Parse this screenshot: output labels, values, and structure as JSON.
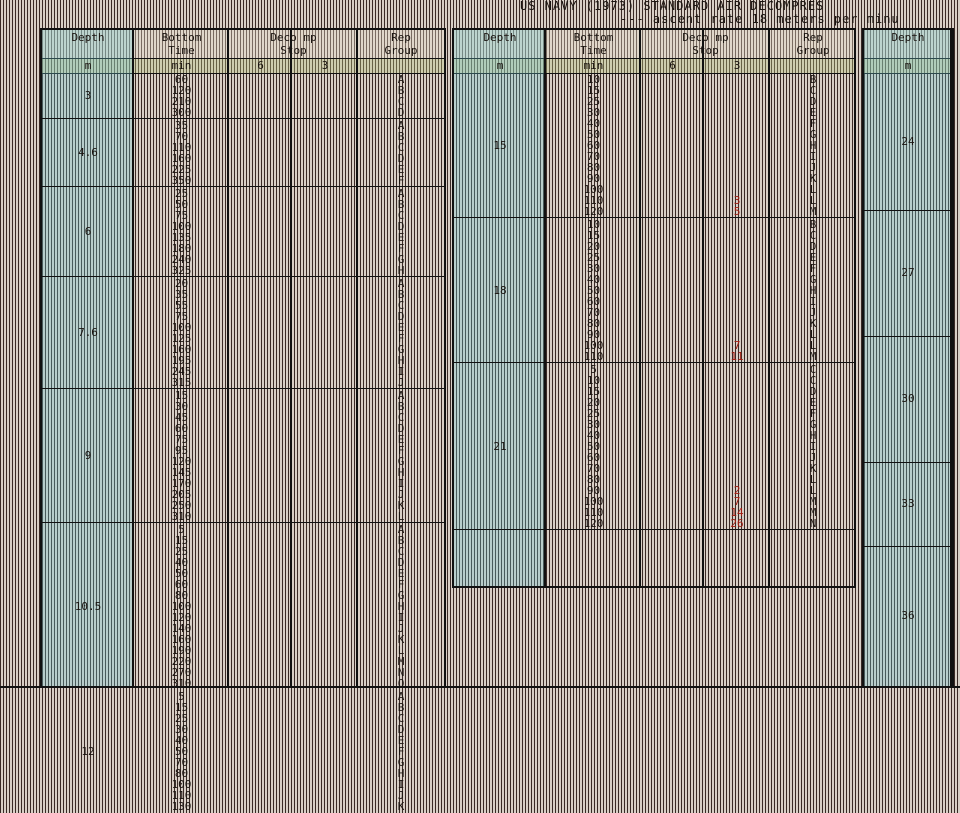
{
  "title": "US  NAVY (1973) STANDARD AIR DECOMPRES",
  "subtitle": "--- ascent rate 18 meters per minu",
  "headers": {
    "depth": "Depth",
    "bottom_time_1": "Bottom",
    "bottom_time_2": "Time",
    "deco_1": "Deco mp",
    "deco_2": "Stop",
    "rep_1": "Rep",
    "rep_2": "Group"
  },
  "units": {
    "depth": "m",
    "time": "min",
    "stop6": "6",
    "stop3": "3"
  },
  "panel1": [
    {
      "depth": "3",
      "rows": [
        [
          "60",
          "",
          "",
          "A"
        ],
        [
          "120",
          "",
          "",
          "B"
        ],
        [
          "210",
          "",
          "",
          "C"
        ],
        [
          "300",
          "",
          "",
          "D"
        ]
      ]
    },
    {
      "depth": "4.6",
      "rows": [
        [
          "35",
          "",
          "",
          "A"
        ],
        [
          "70",
          "",
          "",
          "B"
        ],
        [
          "110",
          "",
          "",
          "C"
        ],
        [
          "160",
          "",
          "",
          "D"
        ],
        [
          "225",
          "",
          "",
          "E"
        ],
        [
          "350",
          "",
          "",
          "F"
        ]
      ]
    },
    {
      "depth": "6",
      "rows": [
        [
          "25",
          "",
          "",
          "A"
        ],
        [
          "50",
          "",
          "",
          "B"
        ],
        [
          "75",
          "",
          "",
          "C"
        ],
        [
          "100",
          "",
          "",
          "D"
        ],
        [
          "135",
          "",
          "",
          "E"
        ],
        [
          "180",
          "",
          "",
          "F"
        ],
        [
          "240",
          "",
          "",
          "G"
        ],
        [
          "325",
          "",
          "",
          "H"
        ]
      ]
    },
    {
      "depth": "7.6",
      "rows": [
        [
          "20",
          "",
          "",
          "A"
        ],
        [
          "35",
          "",
          "",
          "B"
        ],
        [
          "55",
          "",
          "",
          "C"
        ],
        [
          "75",
          "",
          "",
          "D"
        ],
        [
          "100",
          "",
          "",
          "E"
        ],
        [
          "125",
          "",
          "",
          "F"
        ],
        [
          "160",
          "",
          "",
          "G"
        ],
        [
          "195",
          "",
          "",
          "H"
        ],
        [
          "245",
          "",
          "",
          "I"
        ],
        [
          "315",
          "",
          "",
          "J"
        ]
      ]
    },
    {
      "depth": "9",
      "rows": [
        [
          "15",
          "",
          "",
          "A"
        ],
        [
          "30",
          "",
          "",
          "B"
        ],
        [
          "45",
          "",
          "",
          "C"
        ],
        [
          "60",
          "",
          "",
          "D"
        ],
        [
          "75",
          "",
          "",
          "E"
        ],
        [
          "95",
          "",
          "",
          "F"
        ],
        [
          "120",
          "",
          "",
          "G"
        ],
        [
          "145",
          "",
          "",
          "H"
        ],
        [
          "170",
          "",
          "",
          "I"
        ],
        [
          "205",
          "",
          "",
          "J"
        ],
        [
          "250",
          "",
          "",
          "K"
        ],
        [
          "310",
          "",
          "",
          "L"
        ]
      ]
    },
    {
      "depth": "10.5",
      "rows": [
        [
          "5",
          "",
          "",
          "A"
        ],
        [
          "15",
          "",
          "",
          "B"
        ],
        [
          "25",
          "",
          "",
          "C"
        ],
        [
          "40",
          "",
          "",
          "D"
        ],
        [
          "50",
          "",
          "",
          "E"
        ],
        [
          "60",
          "",
          "",
          "F"
        ],
        [
          "80",
          "",
          "",
          "G"
        ],
        [
          "100",
          "",
          "",
          "H"
        ],
        [
          "120",
          "",
          "",
          "I"
        ],
        [
          "140",
          "",
          "",
          "J"
        ],
        [
          "160",
          "",
          "",
          "K"
        ],
        [
          "190",
          "",
          "",
          "L"
        ],
        [
          "220",
          "",
          "",
          "M"
        ],
        [
          "270",
          "",
          "",
          "N"
        ],
        [
          "310",
          "",
          "",
          "O"
        ]
      ]
    },
    {
      "depth": "12",
      "rows": [
        [
          "5",
          "",
          "",
          "A"
        ],
        [
          "15",
          "",
          "",
          "B"
        ],
        [
          "25",
          "",
          "",
          "C"
        ],
        [
          "30",
          "",
          "",
          "D"
        ],
        [
          "40",
          "",
          "",
          "E"
        ],
        [
          "50",
          "",
          "",
          "F"
        ],
        [
          "70",
          "",
          "",
          "G"
        ],
        [
          "80",
          "",
          "",
          "H"
        ],
        [
          "100",
          "",
          "",
          "I"
        ],
        [
          "110",
          "",
          "",
          "J"
        ],
        [
          "130",
          "",
          "",
          "K"
        ]
      ]
    }
  ],
  "panel2": [
    {
      "depth": "15",
      "rows": [
        [
          "10",
          "",
          "",
          "B"
        ],
        [
          "15",
          "",
          "",
          "C"
        ],
        [
          "25",
          "",
          "",
          "D"
        ],
        [
          "30",
          "",
          "",
          "E"
        ],
        [
          "40",
          "",
          "",
          "F"
        ],
        [
          "50",
          "",
          "",
          "G"
        ],
        [
          "60",
          "",
          "",
          "H"
        ],
        [
          "70",
          "",
          "",
          "I"
        ],
        [
          "80",
          "",
          "",
          "J"
        ],
        [
          "90",
          "",
          "",
          "K"
        ],
        [
          "100",
          "",
          "",
          "L"
        ],
        [
          "110",
          "",
          "3",
          "L"
        ],
        [
          "120",
          "",
          "5",
          "M"
        ]
      ]
    },
    {
      "depth": "18",
      "rows": [
        [
          "10",
          "",
          "",
          "B"
        ],
        [
          "15",
          "",
          "",
          "C"
        ],
        [
          "20",
          "",
          "",
          "D"
        ],
        [
          "25",
          "",
          "",
          "E"
        ],
        [
          "30",
          "",
          "",
          "F"
        ],
        [
          "40",
          "",
          "",
          "G"
        ],
        [
          "50",
          "",
          "",
          "H"
        ],
        [
          "60",
          "",
          "",
          "I"
        ],
        [
          "70",
          "",
          "",
          "J"
        ],
        [
          "80",
          "",
          "",
          "K"
        ],
        [
          "90",
          "",
          "",
          "L"
        ],
        [
          "100",
          "",
          "7",
          "L"
        ],
        [
          "110",
          "",
          "11",
          "M"
        ]
      ]
    },
    {
      "depth": "21",
      "rows": [
        [
          "5",
          "",
          "",
          "C"
        ],
        [
          "10",
          "",
          "",
          "C"
        ],
        [
          "15",
          "",
          "",
          "D"
        ],
        [
          "20",
          "",
          "",
          "E"
        ],
        [
          "25",
          "",
          "",
          "F"
        ],
        [
          "30",
          "",
          "",
          "G"
        ],
        [
          "40",
          "",
          "",
          "H"
        ],
        [
          "50",
          "",
          "",
          "I"
        ],
        [
          "60",
          "",
          "",
          "J"
        ],
        [
          "70",
          "",
          "",
          "K"
        ],
        [
          "80",
          "",
          "",
          "L"
        ],
        [
          "90",
          "",
          "2",
          "L"
        ],
        [
          "100",
          "",
          "7",
          "M"
        ],
        [
          "110",
          "",
          "14",
          "M"
        ],
        [
          "120",
          "",
          "26",
          "N"
        ]
      ]
    }
  ],
  "panel3_depths": [
    "24",
    "27",
    "30",
    "33",
    "36"
  ]
}
